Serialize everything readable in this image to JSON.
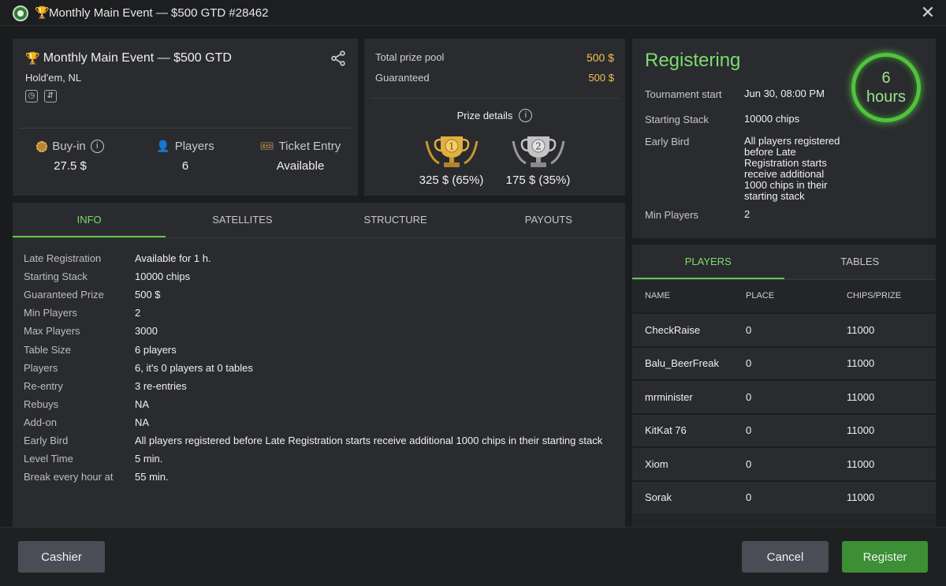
{
  "window": {
    "title": "Monthly Main Event — $500 GTD #28462",
    "logo_icon": "app-logo-icon",
    "trophy_icon": "trophy-icon",
    "close_icon": "close-icon",
    "close_glyph": "✕"
  },
  "header": {
    "title": "Monthly Main Event — $500 GTD",
    "subtitle": "Hold'em, NL",
    "badges": [
      {
        "icon": "clock-badge-icon",
        "glyph": "◷"
      },
      {
        "icon": "reentry-badge-icon",
        "glyph": "⇵"
      }
    ],
    "share_icon": "share-icon",
    "stats": [
      {
        "label": "Buy-in",
        "value": "27.5 $",
        "icon": "chip-icon",
        "info_glyph": "i"
      },
      {
        "label": "Players",
        "value": "6",
        "icon": "person-icon",
        "icon_glyph": "👤"
      },
      {
        "label": "Ticket Entry",
        "value": "Available",
        "icon": "ticket-icon",
        "icon_glyph": "🎟"
      }
    ]
  },
  "prize": {
    "total_label": "Total prize pool",
    "total_value": "500 $",
    "guaranteed_label": "Guaranteed",
    "guaranteed_value": "500 $",
    "details_label": "Prize details",
    "details_info_glyph": "i",
    "places": [
      {
        "place": "1",
        "value": "325 $ (65%)",
        "icon": "gold-trophy-icon",
        "color": "#d4a73a"
      },
      {
        "place": "2",
        "value": "175 $ (35%)",
        "icon": "silver-trophy-icon",
        "color": "#b5b5b5"
      }
    ]
  },
  "status": {
    "title": "Registering",
    "timer_value": "6",
    "timer_unit": "hours",
    "accent_color": "#52c23f",
    "rows": [
      {
        "label": "Tournament start",
        "value": "Jun 30, 08:00 PM"
      },
      {
        "label": "Starting Stack",
        "value": "10000 chips"
      },
      {
        "label": "Early Bird",
        "value": "All players registered before Late Registration starts receive additional 1000 chips in their starting stack"
      },
      {
        "label": "Min Players",
        "value": "2"
      }
    ]
  },
  "tabs": [
    "INFO",
    "SATELLITES",
    "STRUCTURE",
    "PAYOUTS"
  ],
  "info": [
    {
      "label": "Late Registration",
      "value": "Available for 1 h."
    },
    {
      "label": "Starting Stack",
      "value": "10000 chips"
    },
    {
      "label": "Guaranteed Prize",
      "value": "500 $"
    },
    {
      "label": "Min Players",
      "value": "2"
    },
    {
      "label": "Max Players",
      "value": "3000"
    },
    {
      "label": "Table Size",
      "value": "6 players"
    },
    {
      "label": "Players",
      "value": "6, it's 0 players at 0 tables"
    },
    {
      "label": "Re-entry",
      "value": "3 re-entries"
    },
    {
      "label": "Rebuys",
      "value": "NA"
    },
    {
      "label": "Add-on",
      "value": "NA"
    },
    {
      "label": "Early Bird",
      "value": "All players registered before Late Registration starts receive additional 1000 chips in their starting stack"
    },
    {
      "label": "Level Time",
      "value": "5 min."
    },
    {
      "label": "Break every hour at",
      "value": "55 min."
    }
  ],
  "players_tabs": [
    "PLAYERS",
    "TABLES"
  ],
  "players_columns": [
    "NAME",
    "PLACE",
    "CHIPS/PRIZE"
  ],
  "players": [
    {
      "name": "CheckRaise",
      "place": "0",
      "chips": "11000"
    },
    {
      "name": "Balu_BeerFreak",
      "place": "0",
      "chips": "11000"
    },
    {
      "name": "mrminister",
      "place": "0",
      "chips": "11000"
    },
    {
      "name": "KitKat 76",
      "place": "0",
      "chips": "11000"
    },
    {
      "name": "Xiom",
      "place": "0",
      "chips": "11000"
    },
    {
      "name": "Sorak",
      "place": "0",
      "chips": "11000"
    }
  ],
  "footer": {
    "cashier": "Cashier",
    "cancel": "Cancel",
    "register": "Register"
  }
}
